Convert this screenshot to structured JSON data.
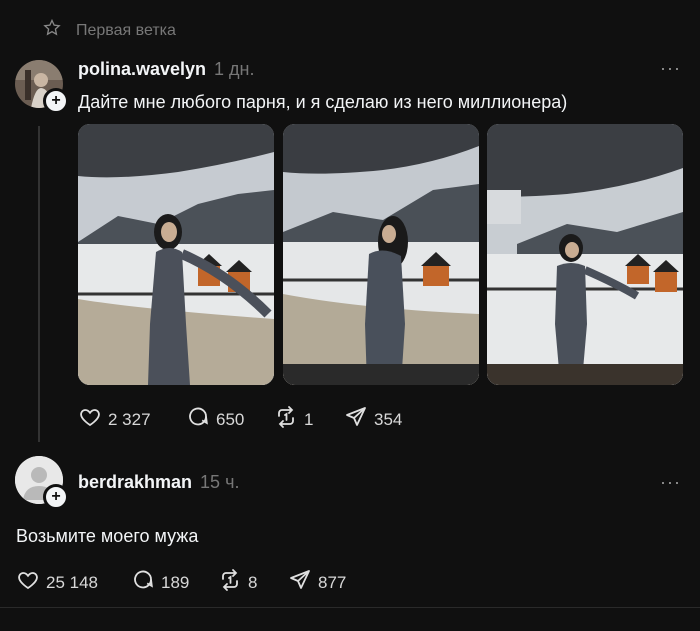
{
  "thread_label": "Первая ветка",
  "post": {
    "username": "polina.wavelyn",
    "time": "1 дн.",
    "text": "Дайте мне любого парня, и я сделаю из него миллионера)",
    "likes": "2 327",
    "comments": "650",
    "reposts": "1",
    "shares": "354"
  },
  "reply": {
    "username": "berdrakhman",
    "time": "15 ч.",
    "text": "Возьмите моего мужа",
    "likes": "25 148",
    "comments": "189",
    "reposts": "8",
    "shares": "877"
  },
  "icons": {
    "star": "star-outline-icon",
    "like": "heart-icon",
    "comment": "comment-bubble-icon",
    "repost": "repost-icon",
    "share": "send-icon",
    "more": "more-dots-icon"
  }
}
